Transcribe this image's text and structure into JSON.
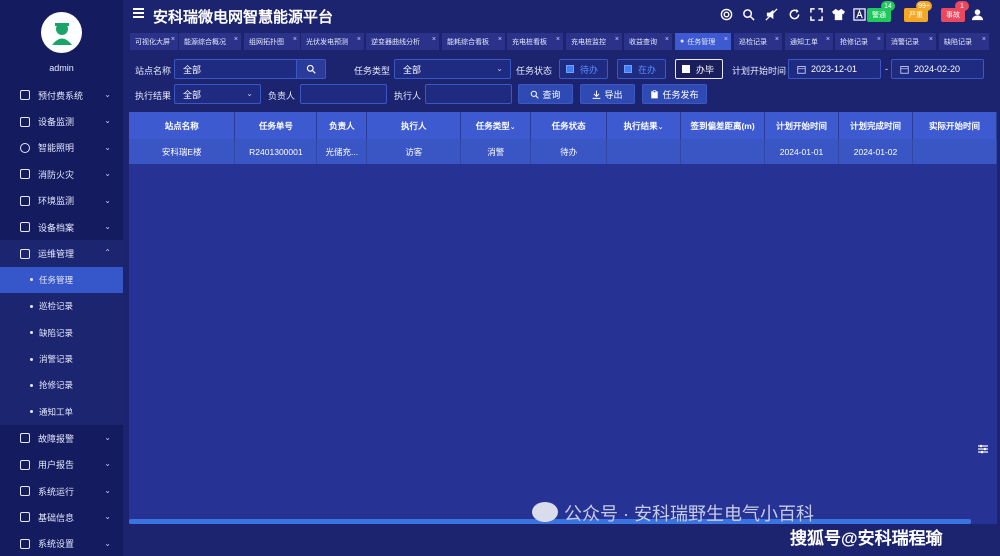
{
  "user": {
    "name": "admin"
  },
  "app": {
    "title": "安科瑞微电网智慧能源平台"
  },
  "colors": {
    "sidebar": "#141b5e",
    "background": "#1c2470",
    "accent": "#3e5ad1",
    "alarm_warn": "#20c95d",
    "alarm_severe": "#f5a623",
    "alarm_incident": "#e9485f"
  },
  "alarms": [
    {
      "label": "警通",
      "count": "14",
      "color": "#20c95d"
    },
    {
      "label": "严重",
      "count": "99+",
      "color": "#f5a623"
    },
    {
      "label": "事故",
      "count": "1",
      "color": "#e9485f"
    }
  ],
  "sidebar": {
    "items": [
      {
        "label": "预付费系统",
        "icon": "prepay-icon"
      },
      {
        "label": "设备监测",
        "icon": "monitor-icon"
      },
      {
        "label": "智能照明",
        "icon": "lightbulb-icon"
      },
      {
        "label": "消防火灾",
        "icon": "fire-extinguisher-icon"
      },
      {
        "label": "环境监测",
        "icon": "environment-icon"
      },
      {
        "label": "设备档案",
        "icon": "archive-icon"
      },
      {
        "label": "运维管理",
        "icon": "ops-icon"
      }
    ],
    "sub_items": [
      "任务管理",
      "巡检记录",
      "缺陷记录",
      "消警记录",
      "抢修记录",
      "通知工单"
    ],
    "bottom_items": [
      {
        "label": "故障报警",
        "icon": "alarm-icon"
      },
      {
        "label": "用户报告",
        "icon": "report-icon"
      },
      {
        "label": "系统运行",
        "icon": "system-run-icon"
      },
      {
        "label": "基础信息",
        "icon": "info-icon"
      },
      {
        "label": "系统设置",
        "icon": "settings-icon"
      }
    ]
  },
  "tabs": [
    {
      "label": "可视化大屏"
    },
    {
      "label": "能源综合概况"
    },
    {
      "label": "组网拓扑图"
    },
    {
      "label": "光伏发电预测"
    },
    {
      "label": "逆变器曲线分析"
    },
    {
      "label": "能耗综合看板"
    },
    {
      "label": "充电桩看板"
    },
    {
      "label": "充电桩监控"
    },
    {
      "label": "收益查询"
    },
    {
      "label": "任务管理"
    },
    {
      "label": "巡检记录"
    },
    {
      "label": "通知工单"
    },
    {
      "label": "抢修记录"
    },
    {
      "label": "消警记录"
    },
    {
      "label": "缺陷记录"
    }
  ],
  "filters": {
    "site_label": "站点名称",
    "site_value": "全部",
    "task_type_label": "任务类型",
    "task_type_value": "全部",
    "task_status_label": "任务状态",
    "status_options": [
      "待办",
      "在办",
      "办毕"
    ],
    "plan_start_label": "计划开始时间",
    "date_from": "2023-12-01",
    "date_sep": "-",
    "date_to": "2024-02-20",
    "exec_result_label": "执行结果",
    "exec_result_value": "全部",
    "owner_label": "负责人",
    "owner_value": "",
    "executor_label": "执行人",
    "executor_value": "",
    "query_btn": "查询",
    "export_btn": "导出",
    "publish_btn": "任务发布"
  },
  "table": {
    "headers": [
      "站点名称",
      "任务单号",
      "负责人",
      "执行人",
      "任务类型",
      "任务状态",
      "执行结果",
      "签到偏差距离(m)",
      "计划开始时间",
      "计划完成时间",
      "实际开始时间"
    ],
    "rows": [
      [
        "安科瑞E楼",
        "R2401300001",
        "光储充...",
        "访客",
        "消警",
        "待办",
        "",
        "",
        "2024-01-01",
        "2024-01-02",
        ""
      ]
    ]
  },
  "watermark": {
    "text": "公众号 · 安科瑞野生电气小百科",
    "text2": "搜狐号@安科瑞程瑜"
  }
}
